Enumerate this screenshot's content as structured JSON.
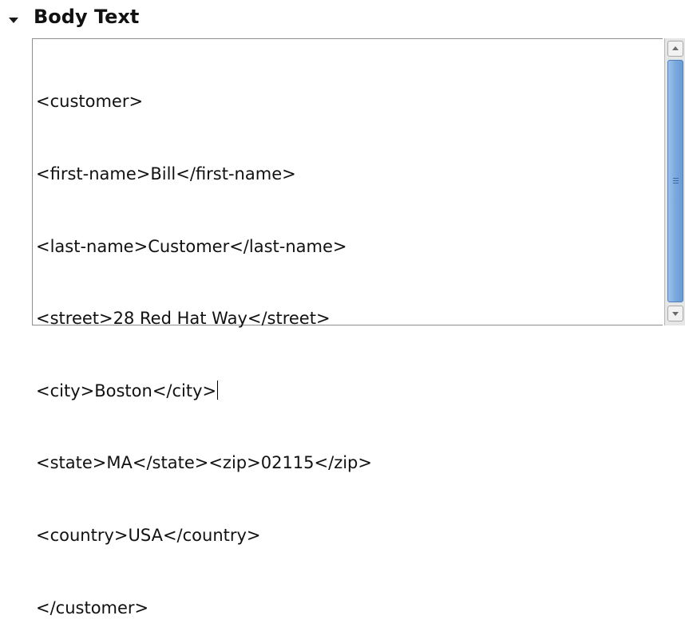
{
  "section": {
    "title": "Body Text",
    "expanded": true
  },
  "body_text": {
    "lines": [
      "<customer>",
      "<first-name>Bill</first-name>",
      "<last-name>Customer</last-name>",
      "<street>28 Red Hat Way</street>",
      "<city>Boston</city>",
      "<state>MA</state><zip>02115</zip>",
      "<country>USA</country>",
      "</customer>"
    ],
    "caret_line": 4
  },
  "scrollbar": {
    "up_icon": "arrow-up-icon",
    "down_icon": "arrow-down-icon",
    "grip_icon": "grip-lines-icon"
  },
  "colors": {
    "scroll_thumb": "#7aa9de",
    "border": "#8e8e8e",
    "text": "#111111"
  }
}
